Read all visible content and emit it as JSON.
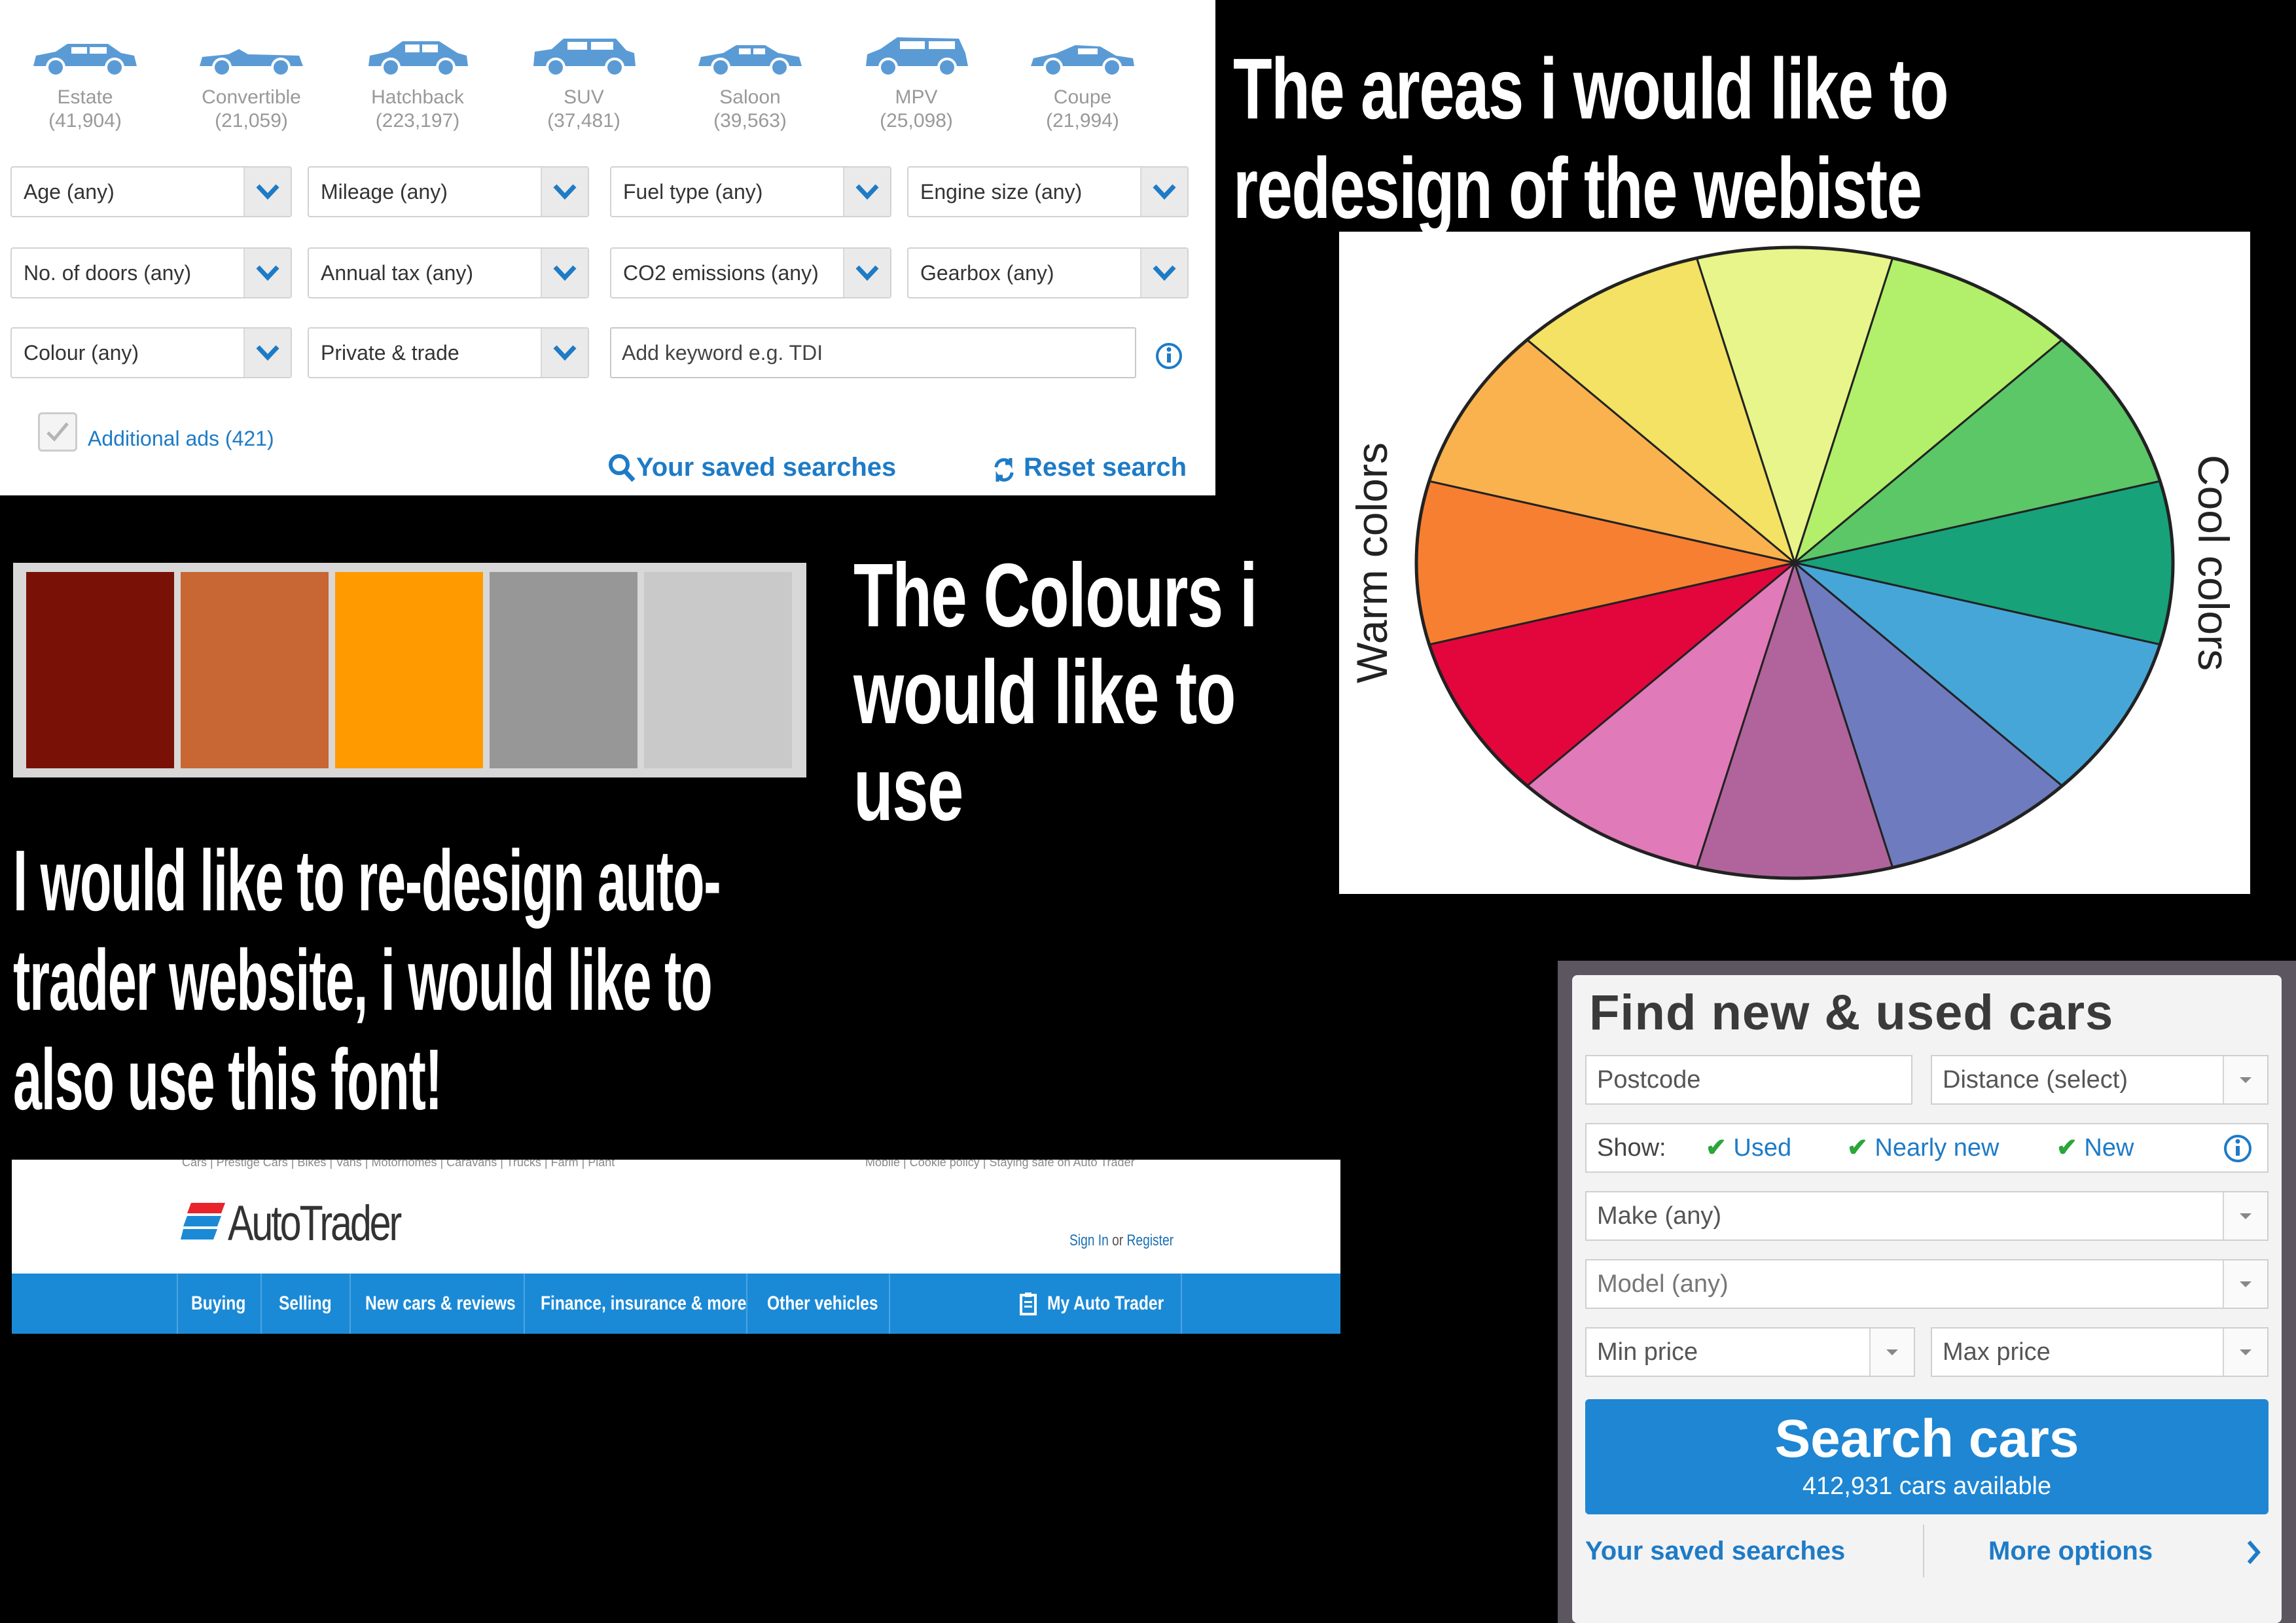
{
  "search_panel": {
    "body_types": [
      {
        "name": "Estate",
        "count": "(41,904)"
      },
      {
        "name": "Convertible",
        "count": "(21,059)"
      },
      {
        "name": "Hatchback",
        "count": "(223,197)"
      },
      {
        "name": "SUV",
        "count": "(37,481)"
      },
      {
        "name": "Saloon",
        "count": "(39,563)"
      },
      {
        "name": "MPV",
        "count": "(25,098)"
      },
      {
        "name": "Coupe",
        "count": "(21,994)"
      }
    ],
    "filters": [
      "Age (any)",
      "Mileage (any)",
      "Fuel type (any)",
      "Engine size (any)",
      "No. of doors (any)",
      "Annual tax (any)",
      "CO2 emissions (any)",
      "Gearbox (any)",
      "Colour (any)",
      "Private & trade"
    ],
    "keyword_placeholder": "Add keyword e.g. TDI",
    "additional_ads": "Additional ads (421)",
    "saved_searches": "Your saved searches",
    "reset_search": "Reset search"
  },
  "headings": {
    "areas": [
      "The areas i would like to",
      "redesign of the webiste"
    ],
    "colours": [
      "The Colours i",
      "would like to",
      "use"
    ],
    "font": [
      "I would like to re-design auto-",
      "trader website, i would like to",
      "also use this font!"
    ]
  },
  "swatches": [
    "#7a1106",
    "#c86634",
    "#ff9a00",
    "#979797",
    "#c9c9c9"
  ],
  "color_wheel": {
    "left_label": "Warm colors",
    "right_label": "Cool colors",
    "segments": [
      "#e8f58a",
      "#b2ef6a",
      "#5cc767",
      "#17a27a",
      "#47a6d8",
      "#6f7bbf",
      "#b0649b",
      "#e07ab8",
      "#e3063c",
      "#f77f32",
      "#f9b24e",
      "#f3e264"
    ]
  },
  "autotrader_header": {
    "top_links_left": "Cars | Prestige Cars | Bikes | Vans | Motorhomes | Caravans | Trucks | Farm | Plant",
    "top_links_right": "Mobile | Cookie policy | Staying safe on Auto Trader",
    "logo": "AutoTrader",
    "sign_in": "Sign In",
    "or": "or",
    "register": "Register",
    "nav": [
      "Buying",
      "Selling",
      "New cars & reviews",
      "Finance, insurance & more",
      "Other vehicles",
      "My Auto Trader"
    ]
  },
  "find_cars": {
    "title": "Find new & used cars",
    "postcode": "Postcode",
    "distance": "Distance (select)",
    "show_label": "Show:",
    "show_options": [
      "Used",
      "Nearly new",
      "New"
    ],
    "make": "Make (any)",
    "model": "Model (any)",
    "min_price": "Min price",
    "max_price": "Max price",
    "search_button": "Search cars",
    "cars_available": "412,931 cars available",
    "saved_searches": "Your saved searches",
    "more_options": "More options"
  }
}
